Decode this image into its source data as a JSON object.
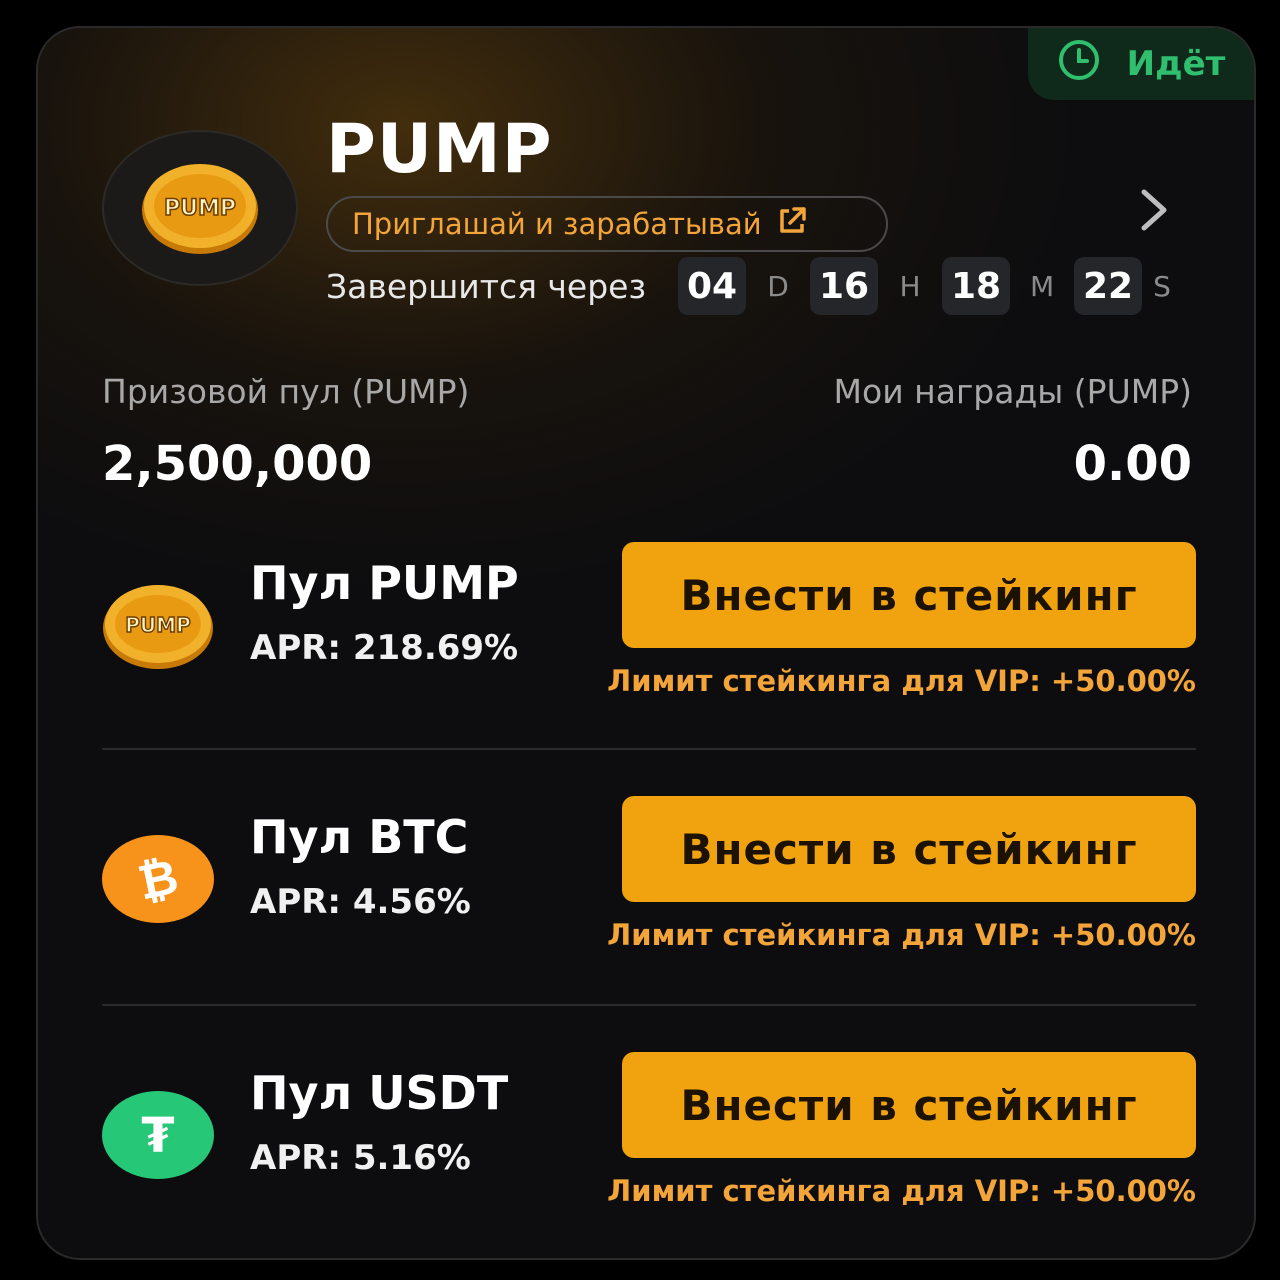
{
  "status": {
    "label": "Идёт",
    "icon": "clock-icon",
    "color": "#2fbf6e"
  },
  "header": {
    "title": "PUMP",
    "coin_text": "PUMP",
    "invite_label": "Приглашай и зарабатывай",
    "invite_icon": "external-link-icon"
  },
  "countdown": {
    "label": "Завершится через",
    "days": "04",
    "days_unit": "D",
    "hours": "16",
    "hours_unit": "H",
    "minutes": "18",
    "minutes_unit": "M",
    "seconds": "22",
    "seconds_unit": "S"
  },
  "stats": {
    "prize_pool_label": "Призовой пул (PUMP)",
    "prize_pool_value": "2,500,000",
    "my_rewards_label": "Мои награды (PUMP)",
    "my_rewards_value": "0.00"
  },
  "pools": [
    {
      "name": "Пул PUMP",
      "apr": "APR: 218.69%",
      "button": "Внести в стейкинг",
      "limit": "Лимит стейкинга для VIP: +50.00%",
      "icon": "pump-coin-icon",
      "coin_text": "PUMP"
    },
    {
      "name": "Пул BTC",
      "apr": "APR: 4.56%",
      "button": "Внести в стейкинг",
      "limit": "Лимит стейкинга для VIP: +50.00%",
      "icon": "btc-coin-icon",
      "coin_text": "₿"
    },
    {
      "name": "Пул USDT",
      "apr": "APR: 5.16%",
      "button": "Внести в стейкинг",
      "limit": "Лимит стейкинга для VIP: +50.00%",
      "icon": "usdt-coin-icon",
      "coin_text": "₮"
    }
  ],
  "colors": {
    "accent": "#f0a20f",
    "accent_text": "#f3a53a",
    "btc": "#f7931a",
    "usdt": "#26c776"
  }
}
